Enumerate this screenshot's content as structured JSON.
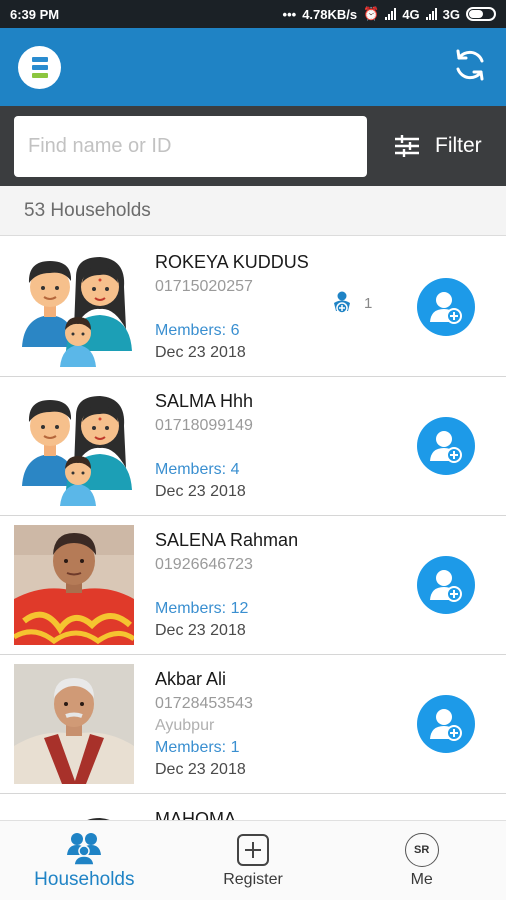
{
  "status_bar": {
    "time": "6:39 PM",
    "speed": "4.78KB/s",
    "network1": "4G",
    "network2": "3G",
    "icons": [
      "dots-icon",
      "alarm-icon",
      "signal-icon",
      "battery-icon"
    ]
  },
  "app_bar": {
    "icons": [
      "app-logo-icon",
      "sync-icon"
    ]
  },
  "search": {
    "placeholder": "Find name or ID",
    "value": "",
    "filter_label": "Filter"
  },
  "summary": {
    "count_text": "53 Households"
  },
  "households": [
    {
      "name": "ROKEYA KUDDUS",
      "phone": "01715020257",
      "members": "Members: 6",
      "date": "Dec 23 2018",
      "child_count": "1",
      "avatar": "family-illustration"
    },
    {
      "name": "SALMA Hhh",
      "phone": "01718099149",
      "members": "Members: 4",
      "date": "Dec 23 2018",
      "avatar": "family-illustration"
    },
    {
      "name": "SALENA Rahman",
      "phone": "01926646723",
      "members": "Members: 12",
      "date": "Dec 23 2018",
      "avatar": "woman-photo"
    },
    {
      "name": "Akbar Ali",
      "phone": "01728453543",
      "location": "Ayubpur",
      "members": "Members: 1",
      "date": "Dec 23 2018",
      "avatar": "man-photo"
    },
    {
      "name": "MAHOMA",
      "avatar": "family-illustration"
    }
  ],
  "bottom_nav": {
    "households": "Households",
    "register": "Register",
    "me": "Me",
    "me_initials": "SR"
  },
  "colors": {
    "primary": "#1f83c5",
    "search_bar": "#3b3d3f",
    "add_button": "#1d9ae8",
    "members_text": "#3a8fd0"
  }
}
